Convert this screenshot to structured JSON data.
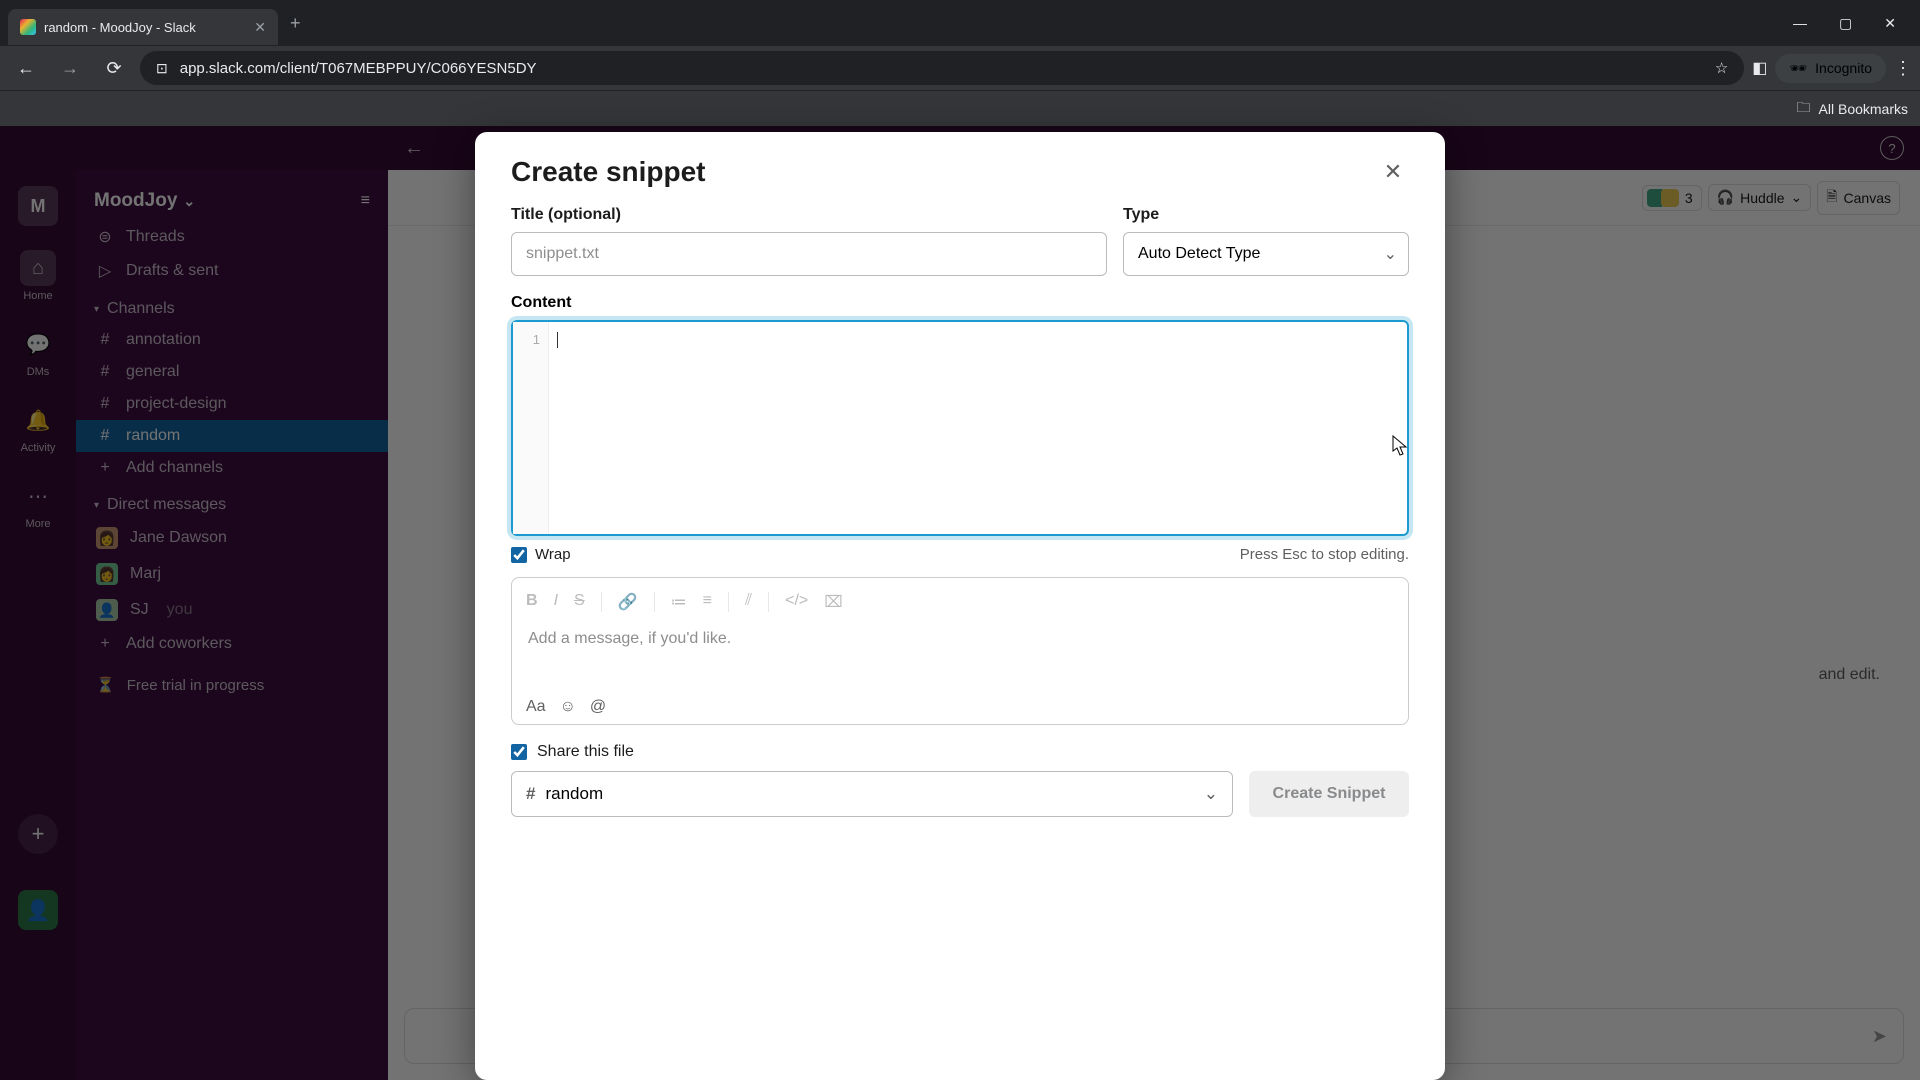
{
  "browser": {
    "tab_title": "random - MoodJoy - Slack",
    "url": "app.slack.com/client/T067MEBPPUY/C066YESN5DY",
    "incognito_label": "Incognito",
    "all_bookmarks": "All Bookmarks"
  },
  "rail": {
    "workspace_initial": "M",
    "items": [
      {
        "label": "Home",
        "icon": "⌂"
      },
      {
        "label": "DMs",
        "icon": "💬"
      },
      {
        "label": "Activity",
        "icon": "🔔"
      },
      {
        "label": "More",
        "icon": "⋯"
      }
    ]
  },
  "sidebar": {
    "workspace": "MoodJoy",
    "threads": "Threads",
    "drafts": "Drafts & sent",
    "channels_label": "Channels",
    "channels": [
      {
        "name": "annotation"
      },
      {
        "name": "general"
      },
      {
        "name": "project-design"
      },
      {
        "name": "random"
      }
    ],
    "add_channels": "Add channels",
    "dms_label": "Direct messages",
    "dms": [
      {
        "name": "Jane Dawson"
      },
      {
        "name": "Marj"
      },
      {
        "name": "SJ",
        "you": "you"
      }
    ],
    "add_coworkers": "Add coworkers",
    "trial": "Free trial in progress"
  },
  "header": {
    "member_count": "3",
    "huddle": "Huddle",
    "canvas": "Canvas"
  },
  "main": {
    "body_text": "and edit."
  },
  "modal": {
    "title": "Create snippet",
    "title_field_label": "Title (optional)",
    "title_placeholder": "snippet.txt",
    "type_label": "Type",
    "type_value": "Auto Detect Type",
    "content_label": "Content",
    "line_number": "1",
    "wrap_label": "Wrap",
    "esc_hint": "Press Esc to stop editing.",
    "message_placeholder": "Add a message, if you'd like.",
    "share_label": "Share this file",
    "share_channel": "random",
    "create_button": "Create Snippet",
    "formatting_text": "Aa"
  }
}
